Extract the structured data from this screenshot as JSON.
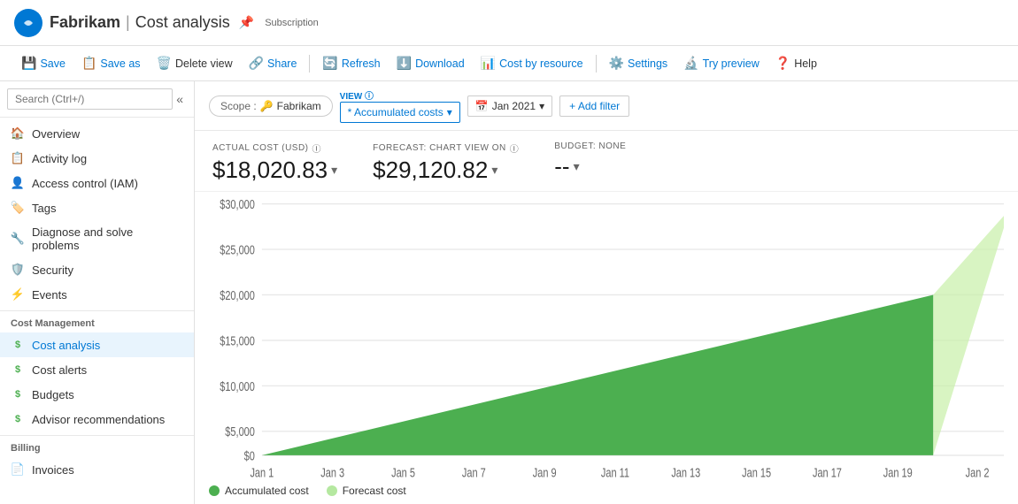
{
  "header": {
    "app_name": "Fabrikam",
    "divider": "|",
    "page_name": "Cost analysis",
    "sub_text": "Subscription",
    "pin_label": "📌"
  },
  "toolbar": {
    "save_label": "Save",
    "save_as_label": "Save as",
    "delete_view_label": "Delete view",
    "share_label": "Share",
    "refresh_label": "Refresh",
    "download_label": "Download",
    "cost_by_resource_label": "Cost by resource",
    "settings_label": "Settings",
    "try_preview_label": "Try preview",
    "help_label": "Help"
  },
  "sidebar": {
    "search_placeholder": "Search (Ctrl+/)",
    "items": [
      {
        "label": "Overview",
        "icon": "🏠",
        "id": "overview"
      },
      {
        "label": "Activity log",
        "icon": "📋",
        "id": "activity-log"
      },
      {
        "label": "Access control (IAM)",
        "icon": "👤",
        "id": "access-control"
      },
      {
        "label": "Tags",
        "icon": "🏷️",
        "id": "tags"
      },
      {
        "label": "Diagnose and solve problems",
        "icon": "🔧",
        "id": "diagnose"
      },
      {
        "label": "Security",
        "icon": "🛡️",
        "id": "security"
      },
      {
        "label": "Events",
        "icon": "⚡",
        "id": "events"
      }
    ],
    "cost_management_label": "Cost Management",
    "cost_items": [
      {
        "label": "Cost analysis",
        "icon": "$",
        "id": "cost-analysis",
        "active": true
      },
      {
        "label": "Cost alerts",
        "icon": "$",
        "id": "cost-alerts"
      },
      {
        "label": "Budgets",
        "icon": "$",
        "id": "budgets"
      },
      {
        "label": "Advisor recommendations",
        "icon": "$",
        "id": "advisor"
      }
    ],
    "billing_label": "Billing",
    "billing_items": [
      {
        "label": "Invoices",
        "icon": "📄",
        "id": "invoices"
      }
    ]
  },
  "content": {
    "scope_label": "Scope :",
    "scope_value": "Fabrikam",
    "view_label": "VIEW ⓘ",
    "view_value": "* Accumulated costs",
    "date_value": "Jan 2021",
    "add_filter_label": "+ Add filter",
    "actual_cost_label": "ACTUAL COST (USD) ⓘ",
    "actual_cost_value": "$18,020.83",
    "forecast_label": "FORECAST: CHART VIEW ON ⓘ",
    "forecast_value": "$29,120.82",
    "budget_label": "BUDGET: NONE",
    "budget_value": "--",
    "chart": {
      "y_labels": [
        "$30,000",
        "$25,000",
        "$20,000",
        "$15,000",
        "$10,000",
        "$5,000",
        "$0"
      ],
      "x_labels": [
        "Jan 1",
        "Jan 3",
        "Jan 5",
        "Jan 7",
        "Jan 9",
        "Jan 11",
        "Jan 13",
        "Jan 15",
        "Jan 17",
        "Jan 19",
        "Jan 2"
      ]
    },
    "legend": {
      "accumulated_label": "Accumulated cost",
      "accumulated_color": "#4caf50",
      "forecast_label": "Forecast cost",
      "forecast_color": "#b5e8a0"
    }
  }
}
